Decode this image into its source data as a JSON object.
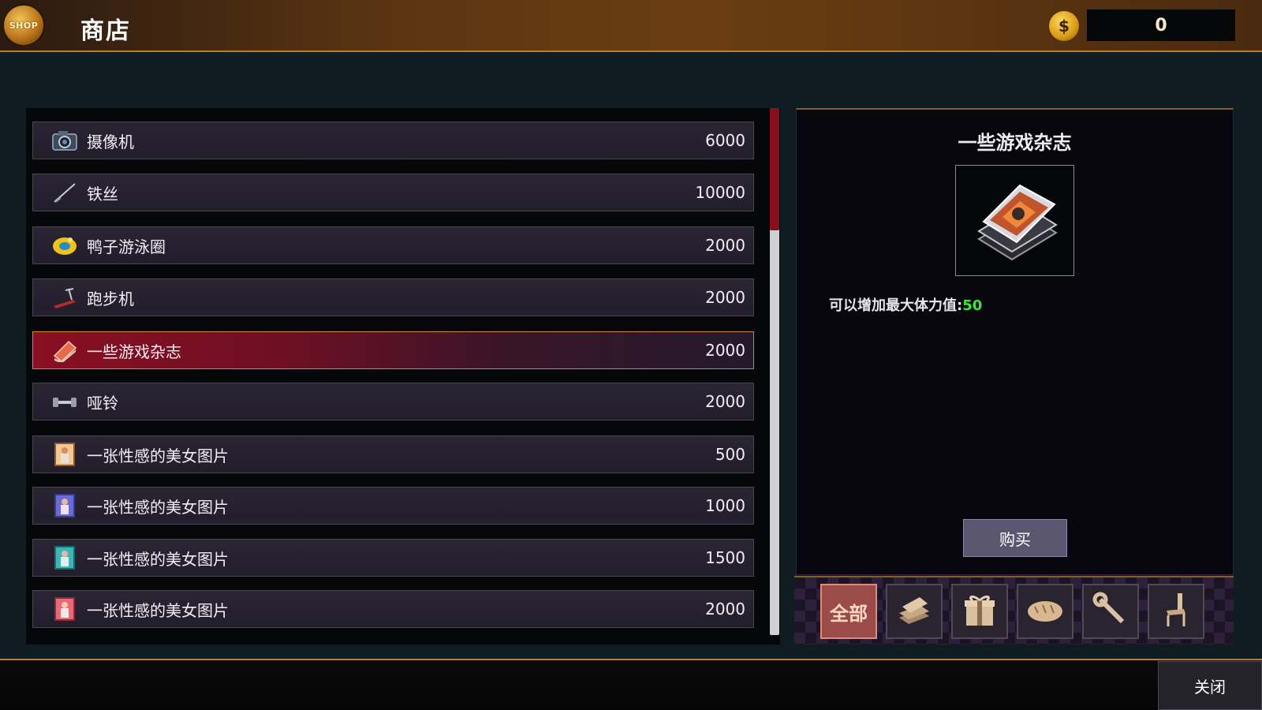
{
  "header": {
    "logo_text": "SHOP",
    "title": "商店",
    "coins": "0"
  },
  "items": [
    {
      "name": "摄像机",
      "price": "6000",
      "icon": "camera-icon"
    },
    {
      "name": "铁丝",
      "price": "10000",
      "icon": "wire-icon"
    },
    {
      "name": "鸭子游泳圈",
      "price": "2000",
      "icon": "swim-ring-icon"
    },
    {
      "name": "跑步机",
      "price": "2000",
      "icon": "treadmill-icon"
    },
    {
      "name": "一些游戏杂志",
      "price": "2000",
      "icon": "magazine-icon",
      "selected": true
    },
    {
      "name": "哑铃",
      "price": "2000",
      "icon": "dumbbell-icon"
    },
    {
      "name": "一张性感的美女图片",
      "price": "500",
      "icon": "picture-icon"
    },
    {
      "name": "一张性感的美女图片",
      "price": "1000",
      "icon": "picture-icon"
    },
    {
      "name": "一张性感的美女图片",
      "price": "1500",
      "icon": "picture-icon"
    },
    {
      "name": "一张性感的美女图片",
      "price": "2000",
      "icon": "picture-icon"
    }
  ],
  "detail": {
    "title": "一些游戏杂志",
    "desc_label": "可以增加最大体力值:",
    "desc_value": "50",
    "buy_label": "购买",
    "image_icon": "magazine-stack-icon"
  },
  "categories": [
    {
      "label": "全部",
      "icon": "all-icon",
      "active": true
    },
    {
      "label": "",
      "icon": "books-icon"
    },
    {
      "label": "",
      "icon": "gift-icon"
    },
    {
      "label": "",
      "icon": "bread-icon"
    },
    {
      "label": "",
      "icon": "wrench-icon"
    },
    {
      "label": "",
      "icon": "chair-icon"
    }
  ],
  "footer": {
    "close_label": "关闭"
  },
  "colors": {
    "accent_orange": "#c07a28",
    "selected_red": "#8a0f22",
    "value_green": "#42e23a"
  }
}
